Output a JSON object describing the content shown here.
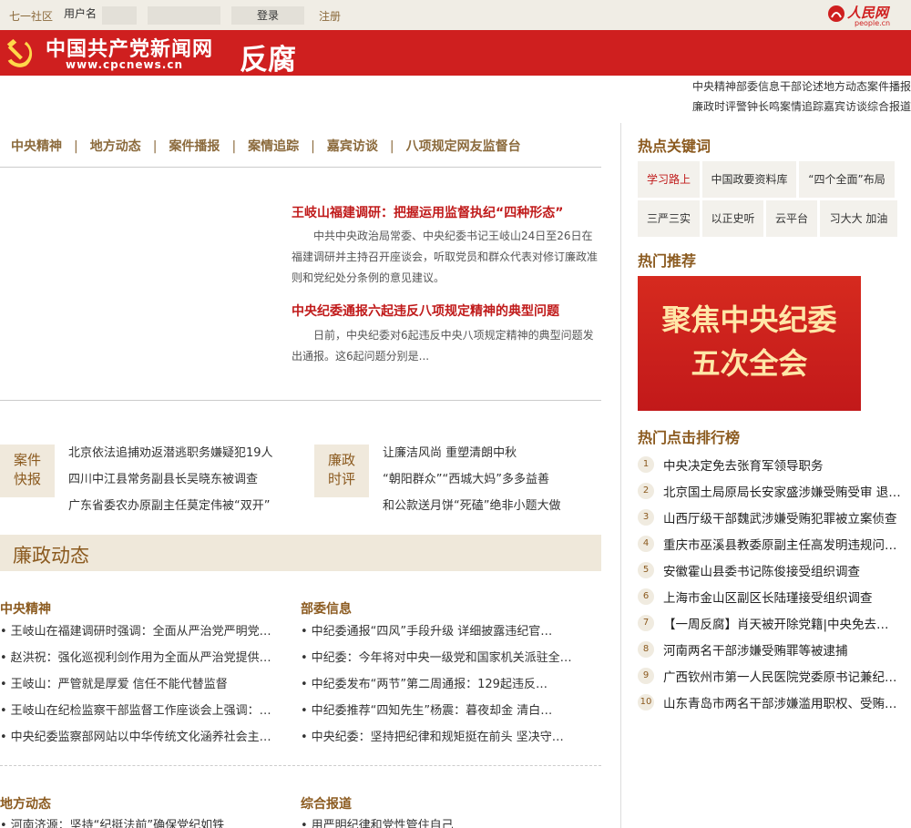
{
  "topbar": {
    "community": "七一社区",
    "username_label": "用户名",
    "login_button": "登录",
    "register_link": "注册",
    "people_logo": "人民网",
    "people_url": "people.cn"
  },
  "banner": {
    "site_name": "中国共产党新闻网",
    "site_url": "www.cpcnews.cn",
    "section": "反腐"
  },
  "top_links": [
    "中央精神部委信息干部论述地方动态案件播报",
    "廉政时评警钟长鸣案情追踪嘉宾访谈综合报道"
  ],
  "nav": [
    "中央精神",
    "地方动态",
    "案件播报",
    "案情追踪",
    "嘉宾访谈",
    "八项规定网友监督台"
  ],
  "nav_sep": "|",
  "stories": [
    {
      "title": "王岐山福建调研：把握运用监督执纪“四种形态”",
      "summary": "中共中央政治局常委、中央纪委书记王岐山24日至26日在福建调研并主持召开座谈会，听取党员和群众代表对修订廉政准则和党纪处分条例的意见建议。"
    },
    {
      "title": "中央纪委通报六起违反八项规定精神的典型问题",
      "summary": "日前，中央纪委对6起违反中央八项规定精神的典型问题发出通报。这6起问题分别是..."
    }
  ],
  "badges": {
    "case": "案件\n快报",
    "comment": "廉政\n时评"
  },
  "case_news": [
    "北京依法追捕劝返潜逃职务嫌疑犯19人",
    "四川中江县常务副县长吴晓东被调查",
    "广东省委农办原副主任莫定伟被“双开”"
  ],
  "comment_news": [
    "让廉洁风尚 重塑清朗中秋",
    "“朝阳群众”“西城大妈”多多益善",
    "和公款送月饼“死磕”绝非小题大做"
  ],
  "dynamics": {
    "title": "廉政动态",
    "central": {
      "heading": "中央精神",
      "items": [
        "王岐山在福建调研时强调：全面从严治党严明党…",
        "赵洪祝：强化巡视利剑作用为全面从严治党提供…",
        "王岐山：严管就是厚爱 信任不能代替监督",
        "王岐山在纪检监察干部监督工作座谈会上强调：…",
        "中央纪委监察部网站以中华传统文化涵养社会主…"
      ]
    },
    "ministry": {
      "heading": "部委信息",
      "items": [
        "中纪委通报“四风”手段升级 详细披露违纪官…",
        "中纪委：今年将对中央一级党和国家机关派驻全…",
        "中纪委发布“两节”第二周通报：129起违反…",
        "中纪委推荐“四知先生”杨震：暮夜却金 清白…",
        "中央纪委：坚持把纪律和规矩挺在前头 坚决守…"
      ]
    },
    "local": {
      "heading": "地方动态",
      "items": [
        "河南济源：坚持“纪挺法前”确保党纪如铁"
      ]
    },
    "general": {
      "heading": "综合报道",
      "items": [
        "用严明纪律和党性管住自己"
      ]
    }
  },
  "hot_keywords": {
    "title": "热点关键词",
    "items": [
      "学习路上",
      "中国政要资料库",
      "“四个全面”布局",
      "三严三实",
      "以正史听",
      "云平台",
      "习大大 加油"
    ]
  },
  "hot_recommend": {
    "title": "热门推荐",
    "promo_line1": "聚焦中央纪委",
    "promo_line2": "五次全会"
  },
  "ranking": {
    "title": "热门点击排行榜",
    "items": [
      {
        "n": "1",
        "t": "中央决定免去张育军领导职务"
      },
      {
        "n": "2",
        "t": "北京国土局原局长安家盛涉嫌受贿受审 退…"
      },
      {
        "n": "3",
        "t": "山西厅级干部魏武涉嫌受贿犯罪被立案侦查"
      },
      {
        "n": "4",
        "t": "重庆市巫溪县教委原副主任高发明违规问…"
      },
      {
        "n": "5",
        "t": "安徽霍山县委书记陈俊接受组织调查"
      },
      {
        "n": "6",
        "t": "上海市金山区副区长陆瑾接受组织调查"
      },
      {
        "n": "7",
        "t": "【一周反腐】肖天被开除党籍|中央免去…"
      },
      {
        "n": "8",
        "t": "河南两名干部涉嫌受贿罪等被逮捕"
      },
      {
        "n": "9",
        "t": "广西钦州市第一人民医院党委原书记兼纪…"
      },
      {
        "n": "10",
        "t": "山东青岛市两名干部涉嫌滥用职权、受贿…"
      }
    ]
  },
  "colors": {
    "brand_red": "#cf1f1f",
    "gold": "#8b5a1f",
    "headline_red": "#c01a1a"
  }
}
